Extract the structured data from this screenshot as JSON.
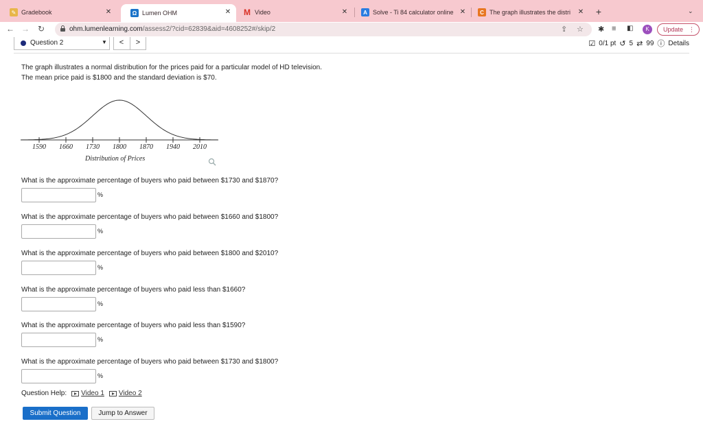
{
  "browser": {
    "tabs": [
      {
        "title": "Gradebook",
        "favicon": "pencil-icon",
        "favicon_color": "#e8b64a"
      },
      {
        "title": "Lumen OHM",
        "favicon": "lumen-icon",
        "favicon_color": "#1a73c9",
        "active": true
      },
      {
        "title": "Video",
        "favicon": "gmail-icon",
        "favicon_color": "#d93025"
      },
      {
        "title": "Solve - Ti 84 calculator online",
        "favicon": "solve-icon",
        "favicon_color": "#2a7de1"
      },
      {
        "title": "The graph illustrates the distri",
        "favicon": "chegg-icon",
        "favicon_color": "#e87722"
      }
    ],
    "new_tab": "+",
    "url_host": "ohm.lumenlearning.com",
    "url_path": "/assess2/?cid=62839&aid=4608252#/skip/2",
    "avatar_initial": "K",
    "update_label": "Update",
    "accent": "#f7c9cf"
  },
  "header": {
    "question_select": "Question 2",
    "prev": "<",
    "next": ">",
    "score": "0/1 pt",
    "retries": "5",
    "attempts": "99",
    "details": "Details"
  },
  "intro": {
    "line1": "The graph illustrates a normal distribution for the prices paid for a particular model of HD television.",
    "line2": "The mean price paid is $1800 and the standard deviation is $70."
  },
  "graph": {
    "ticks": [
      "1590",
      "1660",
      "1730",
      "1800",
      "1870",
      "1940",
      "2010"
    ],
    "caption": "Distribution of Prices"
  },
  "questions": [
    {
      "text": "What is the approximate percentage of buyers who paid between $1730 and $1870?",
      "value": "",
      "unit": "%"
    },
    {
      "text": "What is the approximate percentage of buyers who paid between $1660 and $1800?",
      "value": "",
      "unit": "%"
    },
    {
      "text": "What is the approximate percentage of buyers who paid between $1800 and $2010?",
      "value": "",
      "unit": "%"
    },
    {
      "text": "What is the approximate percentage of buyers who paid less than $1660?",
      "value": "",
      "unit": "%"
    },
    {
      "text": "What is the approximate percentage of buyers who paid less than $1590?",
      "value": "",
      "unit": "%"
    },
    {
      "text": "What is the approximate percentage of buyers who paid between $1730 and $1800?",
      "value": "",
      "unit": "%"
    }
  ],
  "help": {
    "label": "Question Help:",
    "video1": "Video 1",
    "video2": "Video 2"
  },
  "actions": {
    "submit": "Submit Question",
    "jump": "Jump to Answer",
    "submit_color": "#1a6fc9"
  }
}
